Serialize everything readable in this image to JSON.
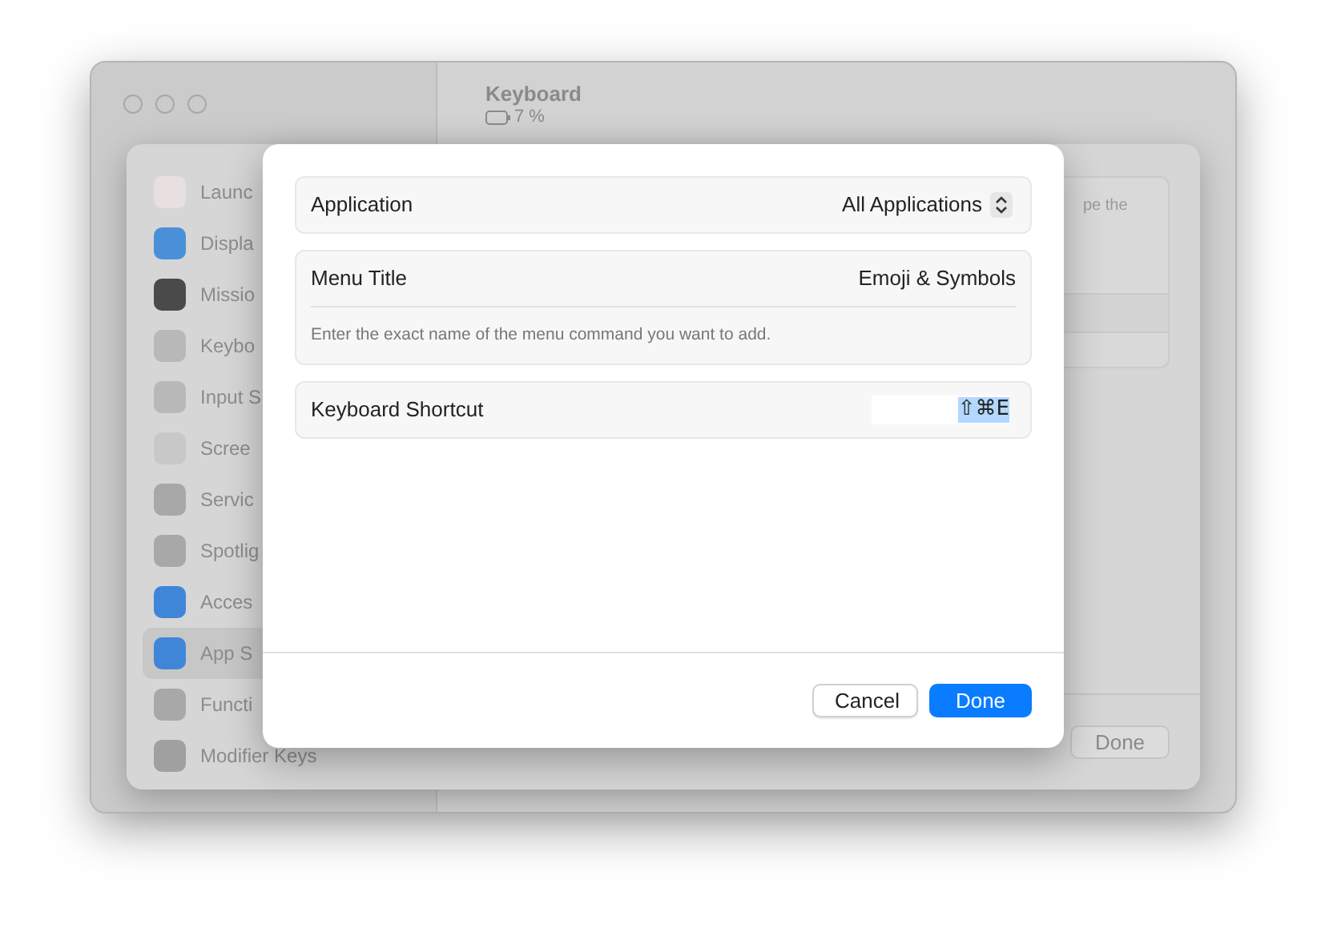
{
  "back_window": {
    "title": "Keyboard",
    "battery": "7 %"
  },
  "sheet": {
    "sidebar_items": [
      {
        "label": "Launc",
        "color": "#e8e0e0",
        "selected": false
      },
      {
        "label": "Displa",
        "color": "#4a90d9",
        "selected": false
      },
      {
        "label": "Missio",
        "color": "#4a4a4a",
        "selected": false
      },
      {
        "label": "Keybo",
        "color": "#b8b8b8",
        "selected": false
      },
      {
        "label": "Input S",
        "color": "#b8b8b8",
        "selected": false
      },
      {
        "label": "Scree",
        "color": "#c8c8c8",
        "selected": false
      },
      {
        "label": "Servic",
        "color": "#a8a8a8",
        "selected": false
      },
      {
        "label": "Spotlig",
        "color": "#a8a8a8",
        "selected": false
      },
      {
        "label": "Acces",
        "color": "#3f86d9",
        "selected": false
      },
      {
        "label": "App S",
        "color": "#3f86d9",
        "selected": true
      },
      {
        "label": "Functi",
        "color": "#a8a8a8",
        "selected": false
      },
      {
        "label": "Modifier Keys",
        "color": "#a0a0a0",
        "selected": false
      }
    ],
    "panel_text": "pe the",
    "done_button": "Done"
  },
  "dialog": {
    "rows": [
      {
        "kind": "popup",
        "label": "Application",
        "value": "All Applications"
      },
      {
        "kind": "text",
        "label": "Menu Title",
        "value": "Emoji & Symbols",
        "hint": "Enter the exact name of the menu command you want to add."
      },
      {
        "kind": "shortcut",
        "label": "Keyboard Shortcut",
        "value": "⇧⌘E"
      }
    ],
    "buttons": [
      {
        "label": "Cancel",
        "default": false
      },
      {
        "label": "Done",
        "default": true
      }
    ]
  }
}
